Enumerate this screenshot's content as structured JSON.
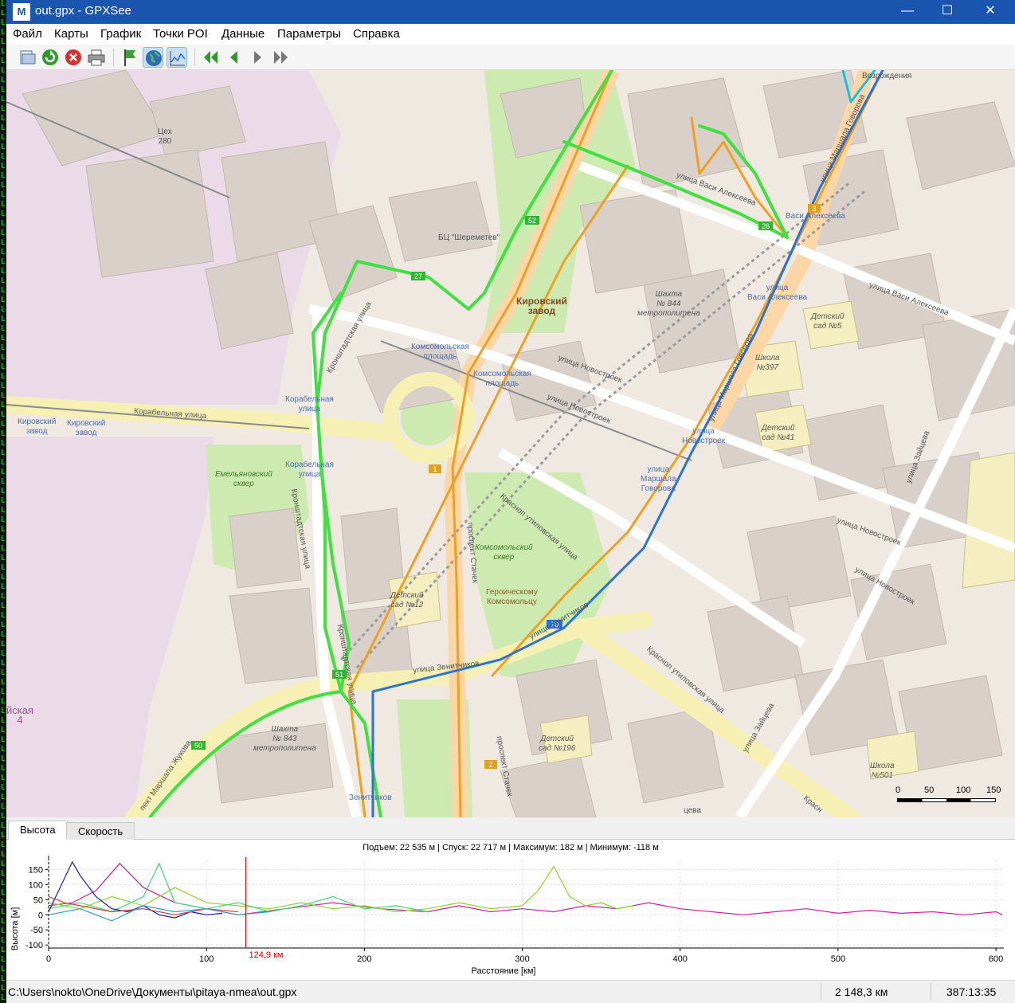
{
  "window": {
    "title": "out.gpx - GPXSee",
    "icon_glyph": "M"
  },
  "menu": [
    "Файл",
    "Карты",
    "График",
    "Точки POI",
    "Данные",
    "Параметры",
    "Справка"
  ],
  "toolbar": {
    "buttons": [
      "open-icon",
      "reload-icon",
      "close-file-icon",
      "print-icon",
      "show-poi-icon",
      "show-map-icon",
      "show-graphs-icon",
      "first-icon",
      "previous-icon",
      "next-icon",
      "last-icon"
    ]
  },
  "map": {
    "labels": {
      "l1": "Цех\n280",
      "l2": "БЦ \"Шереметев\"",
      "l3": "Кировский\nзавод",
      "l4": "Шахта\n№ 844\nметрополитена",
      "l5": "Комсомольская\nплощадь",
      "l6": "Комсомольская\nплощадь",
      "l7": "улица Новостроек",
      "l8": "улица Новостроек",
      "l9": "Корабельная\nулица",
      "l10": "Корабельная улица",
      "l11": "Кировский\nзавод",
      "l12": "Кировский\nзавод",
      "l13": "Корабельная\nулица",
      "l14": "Емельяновский\nсквер",
      "l15": "Кронштадтская улица",
      "l16": "проспект Стачек",
      "l17": "Комсомольский\nсквер",
      "l18": "Героическому\nКомсомольцу",
      "l19": "Детский\nсад №12",
      "l20": "улица Зенитчиков",
      "l21": "улица Зенитчиков",
      "l22": "Шахта\n№ 843\nметрополитена",
      "l23": "Детский\nсад №196",
      "l24": "Красноп утиловская улица",
      "l25": "Красноп утиловская улица",
      "l26": "улица Васи Алексеева",
      "l27": "Васи Алексеева",
      "l28": "улица\nВаси Алексеева",
      "l29": "улица Васи Алексеева",
      "l30": "Детский\nсад №5",
      "l31": "Школа\n№397",
      "l32": "Детский\nсад №41",
      "l33": "улица\nМаршала\nГоворова",
      "l34": "улица\nНовостроек",
      "l35": "улица Новостроек",
      "l36": "улица Новостроек",
      "l37": "улица Зайцева",
      "l38": "улица Зайцева",
      "l39": "Школа\n№501",
      "l40": "Возрождения",
      "l41": "улица Маршала Говорова",
      "l42": "улица Маршала Говорова",
      "l43": "Зенитчиков",
      "l44": "пект Маршала Жукова",
      "l45": "йская\n4",
      "l46": "проспект Стачек",
      "l47": "Кронштадтская улица",
      "l48": "Кронштадтская улица",
      "l49": "Красн",
      "l50": "цева"
    },
    "route_badges": {
      "b1": "52",
      "b2": "27",
      "b3": "26",
      "b4": "51",
      "b5": "50",
      "b6": "1",
      "b7": "2",
      "b8": "70",
      "b9": "3"
    },
    "scale": {
      "l0": "0",
      "l50": "50",
      "l100": "100",
      "l150": "150"
    }
  },
  "graph_tabs": [
    "Высота",
    "Скорость"
  ],
  "graph": {
    "stats": "Подъем: 22 535 м | Спуск: 22 717 м | Максимум: 182 м | Минимум: -118 м",
    "ylabel": "Высота [м]",
    "xlabel": "Расстояние [км]",
    "marker_label": "124,9 км",
    "yticks": [
      "150",
      "100",
      "50",
      "0",
      "-50",
      "-100"
    ],
    "xticks": [
      "0",
      "100",
      "200",
      "300",
      "400",
      "500",
      "600"
    ]
  },
  "chart_data": {
    "type": "line",
    "xlabel": "Расстояние [км]",
    "ylabel": "Высота [м]",
    "xlim": [
      0,
      605
    ],
    "ylim": [
      -110,
      180
    ],
    "marker_x": 124.9,
    "series": [
      {
        "color": "#cc1f9a",
        "x": [
          0,
          15,
          30,
          45,
          60,
          80,
          100,
          120,
          150,
          180,
          210,
          240,
          260,
          280,
          300,
          320,
          340,
          360,
          380,
          400,
          420,
          440,
          460,
          480,
          500,
          520,
          540,
          560,
          580,
          600,
          604
        ],
        "y": [
          30,
          40,
          80,
          170,
          90,
          40,
          20,
          0,
          20,
          40,
          20,
          10,
          30,
          10,
          20,
          10,
          30,
          20,
          40,
          20,
          10,
          0,
          10,
          20,
          5,
          15,
          5,
          10,
          0,
          10,
          0
        ]
      },
      {
        "color": "#8cd42a",
        "x": [
          0,
          20,
          40,
          60,
          80,
          100,
          120,
          140,
          160,
          180,
          200,
          220,
          240,
          260,
          280,
          300,
          310,
          320,
          330,
          340,
          350,
          360,
          370
        ],
        "y": [
          40,
          20,
          60,
          30,
          90,
          40,
          30,
          20,
          40,
          20,
          30,
          10,
          20,
          40,
          20,
          30,
          80,
          160,
          60,
          30,
          40,
          20,
          30
        ]
      },
      {
        "color": "#3fd87a",
        "x": [
          0,
          20,
          40,
          60,
          70,
          80,
          90,
          100,
          120,
          140,
          160,
          180,
          200,
          220,
          240
        ],
        "y": [
          20,
          40,
          10,
          60,
          170,
          40,
          30,
          20,
          40,
          10,
          30,
          60,
          20,
          30,
          10
        ]
      },
      {
        "color": "#1a1ab0",
        "x": [
          0,
          10,
          15,
          20,
          30,
          40,
          50,
          60,
          70,
          80,
          90,
          100,
          110
        ],
        "y": [
          10,
          120,
          175,
          130,
          60,
          20,
          10,
          30,
          0,
          -10,
          10,
          0,
          5
        ]
      },
      {
        "color": "#c94040",
        "x": [
          0,
          10,
          20,
          40,
          60,
          80,
          100,
          120
        ],
        "y": [
          60,
          40,
          30,
          10,
          20,
          0,
          20,
          10
        ]
      },
      {
        "color": "#2fa0c8",
        "x": [
          0,
          20,
          40,
          60,
          80,
          100,
          120,
          140
        ],
        "y": [
          0,
          20,
          -20,
          30,
          10,
          20,
          0,
          10
        ]
      }
    ]
  },
  "status": {
    "path": "C:\\Users\\nokto\\OneDrive\\Документы\\pitaya-nmea\\out.gpx",
    "distance": "2 148,3 км",
    "time": "387:13:35"
  }
}
